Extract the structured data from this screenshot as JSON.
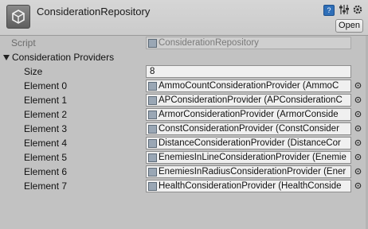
{
  "header": {
    "title": "ConsiderationRepository",
    "help_label": "?",
    "open_label": "Open"
  },
  "script_row": {
    "label": "Script",
    "value": "ConsiderationRepository"
  },
  "foldout": {
    "label": "Consideration Providers"
  },
  "size_row": {
    "label": "Size",
    "value": "8"
  },
  "elements": [
    {
      "label": "Element 0",
      "value": "AmmoCountConsiderationProvider (AmmoC"
    },
    {
      "label": "Element 1",
      "value": "APConsiderationProvider (APConsiderationC"
    },
    {
      "label": "Element 2",
      "value": "ArmorConsiderationProvider (ArmorConside"
    },
    {
      "label": "Element 3",
      "value": "ConstConsiderationProvider (ConstConsider"
    },
    {
      "label": "Element 4",
      "value": "DistanceConsiderationProvider (DistanceCor"
    },
    {
      "label": "Element 5",
      "value": "EnemiesInLineConsiderationProvider (Enemie"
    },
    {
      "label": "Element 6",
      "value": "EnemiesInRadiusConsiderationProvider (Ener"
    },
    {
      "label": "Element 7",
      "value": "HealthConsiderationProvider (HealthConside"
    }
  ],
  "colors": {
    "background": "#c2c2c2",
    "field": "#f0f0f0",
    "help_icon": "#2f6fb8"
  }
}
